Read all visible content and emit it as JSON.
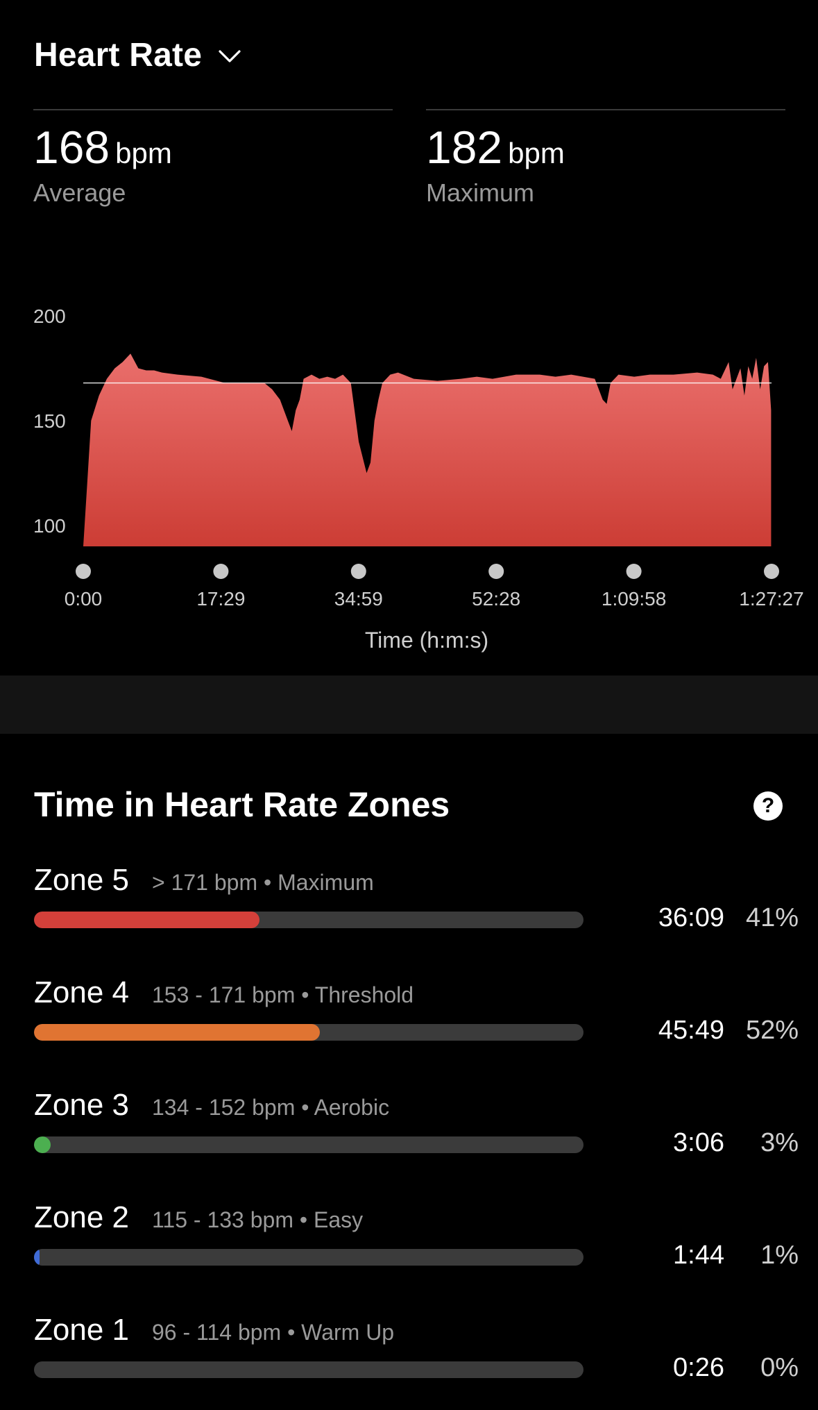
{
  "header": {
    "title": "Heart Rate",
    "chevron_icon": "chevron-down-icon"
  },
  "stats": {
    "average": {
      "value": "168",
      "unit": "bpm",
      "label": "Average"
    },
    "maximum": {
      "value": "182",
      "unit": "bpm",
      "label": "Maximum"
    }
  },
  "chart_data": {
    "type": "area",
    "title": "",
    "xlabel": "Time (h:m:s)",
    "ylabel": "",
    "ylim": [
      90,
      205
    ],
    "y_ticks": [
      "100",
      "150",
      "200"
    ],
    "x_tick_labels": [
      "0:00",
      "17:29",
      "34:59",
      "52:28",
      "1:09:58",
      "1:27:27"
    ],
    "average_line": 168,
    "fill_color_top": "#ea6f6c",
    "fill_color_bottom": "#cc3d35",
    "series": [
      {
        "x_minutes": [
          0,
          0.5,
          1,
          2,
          3,
          4,
          5,
          6,
          7,
          8,
          9,
          10,
          12,
          15,
          18,
          20,
          23,
          24,
          25,
          26,
          26.5,
          27,
          27.5,
          28,
          29,
          30,
          31,
          32,
          33,
          34,
          35,
          36,
          36.5,
          37,
          37.5,
          38,
          39,
          40,
          42,
          45,
          48,
          50,
          52,
          55,
          58,
          60,
          62,
          65,
          66,
          66.5,
          67,
          68,
          70,
          72,
          75,
          78,
          80,
          81,
          82,
          82.5,
          83,
          83.5,
          84,
          84.5,
          85,
          85.5,
          86,
          86.5,
          87,
          87.4
        ],
        "bpm": [
          90,
          120,
          150,
          162,
          170,
          175,
          178,
          182,
          175,
          174,
          174,
          173,
          172,
          171,
          168,
          168,
          168,
          165,
          160,
          150,
          145,
          155,
          160,
          170,
          172,
          170,
          171,
          170,
          172,
          168,
          140,
          125,
          130,
          150,
          160,
          168,
          172,
          173,
          170,
          169,
          170,
          171,
          170,
          172,
          172,
          171,
          172,
          170,
          160,
          158,
          168,
          172,
          171,
          172,
          172,
          173,
          172,
          170,
          178,
          165,
          170,
          175,
          162,
          176,
          170,
          180,
          165,
          176,
          178,
          155
        ]
      }
    ]
  },
  "zones_section": {
    "title": "Time in Heart Rate Zones",
    "help_icon": "question-mark-icon",
    "zones": [
      {
        "name": "Zone 5",
        "desc": "> 171 bpm • Maximum",
        "time": "36:09",
        "pct": "41%",
        "fill": 0.41,
        "color": "#d4403a"
      },
      {
        "name": "Zone 4",
        "desc": "153 - 171 bpm • Threshold",
        "time": "45:49",
        "pct": "52%",
        "fill": 0.52,
        "color": "#e07432"
      },
      {
        "name": "Zone 3",
        "desc": "134 - 152 bpm • Aerobic",
        "time": "3:06",
        "pct": "3%",
        "fill": 0.03,
        "color": "#4caf50"
      },
      {
        "name": "Zone 2",
        "desc": "115 - 133 bpm • Easy",
        "time": "1:44",
        "pct": "1%",
        "fill": 0.01,
        "color": "#3f6bd6"
      },
      {
        "name": "Zone 1",
        "desc": "96 - 114 bpm • Warm Up",
        "time": "0:26",
        "pct": "0%",
        "fill": 0.0,
        "color": "#888888"
      }
    ]
  }
}
